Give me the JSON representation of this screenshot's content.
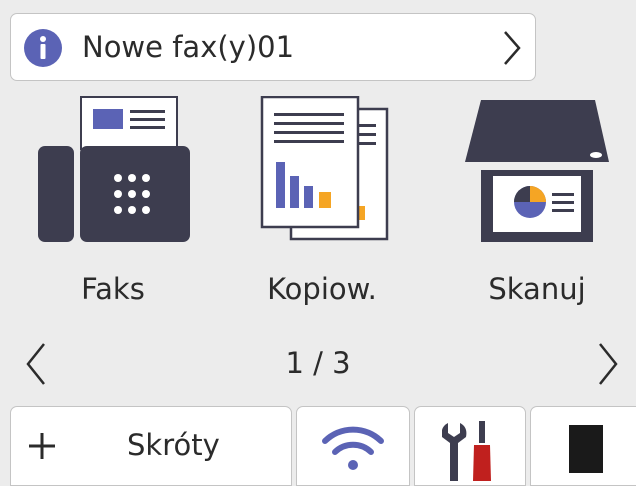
{
  "notification": {
    "text": "Nowe fax(y)01"
  },
  "apps": [
    {
      "label": "Faks"
    },
    {
      "label": "Kopiow."
    },
    {
      "label": "Skanuj"
    }
  ],
  "pager": {
    "text": "1 / 3"
  },
  "tabs": {
    "shortcuts_label": "Skróty"
  },
  "icons": {
    "notification": "info-icon",
    "notification_arrow": "chevron-right-icon",
    "fax": "fax-icon",
    "copy": "copy-icon",
    "scan": "scan-icon",
    "prev": "chevron-left-icon",
    "next": "chevron-right-icon",
    "shortcuts": "plus-icon",
    "wifi": "wifi-icon",
    "settings": "wrench-screwdriver-icon",
    "toner": "toner-icon"
  },
  "colors": {
    "background": "#ececec",
    "panel": "#ffffff",
    "dark": "#3d3d4f",
    "accent_blue": "#5b63b5",
    "accent_orange": "#f5a524",
    "screwdriver_red": "#c0201e",
    "toner": "#1a1a1a"
  }
}
